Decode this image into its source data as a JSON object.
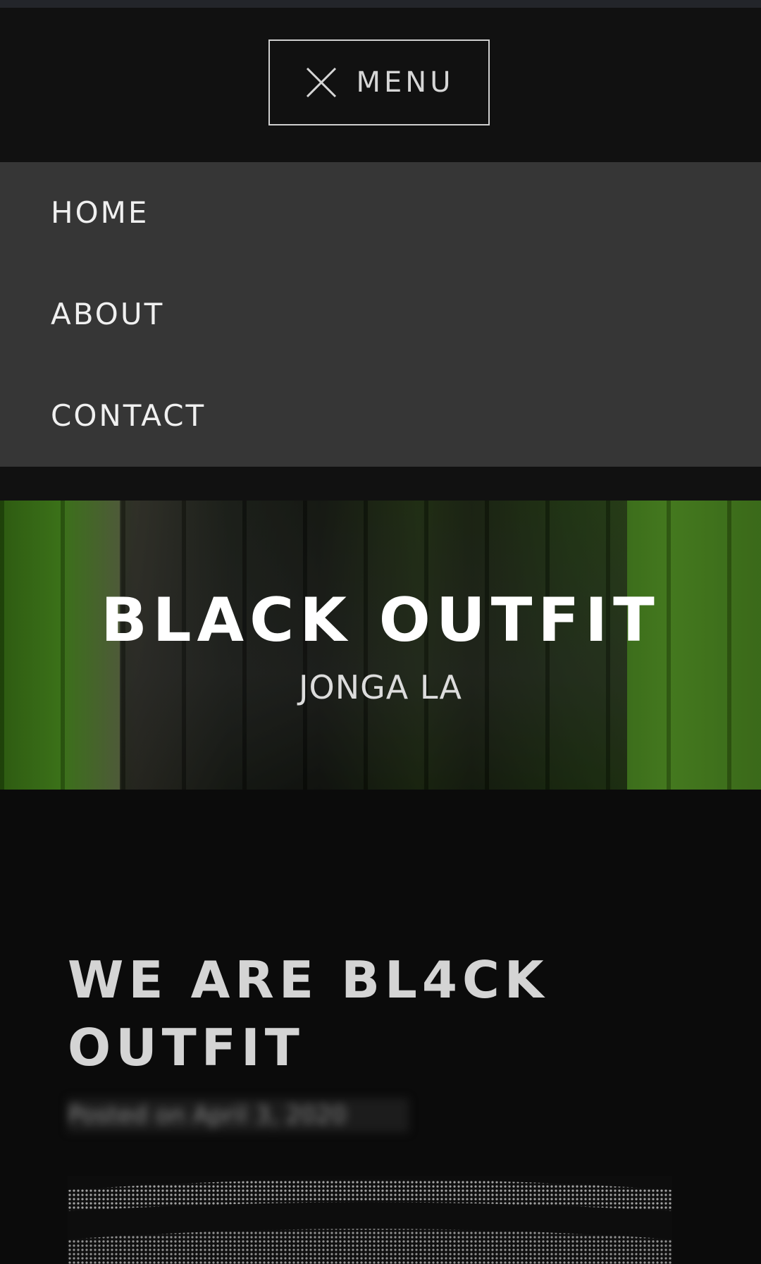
{
  "header": {
    "menu_label": "MENU",
    "menu_icon": "close-icon"
  },
  "nav": {
    "items": [
      {
        "label": "HOME"
      },
      {
        "label": "ABOUT"
      },
      {
        "label": "CONTACT"
      }
    ]
  },
  "hero": {
    "title": "BLACK OUTFIT",
    "subtitle": "JONGA LA"
  },
  "post": {
    "title": "WE ARE BL4CK OUTFIT",
    "date": "Posted on April 3, 2020"
  },
  "colors": {
    "header_bg": "#111111",
    "nav_bg": "#363636",
    "page_bg": "#0b0b0b"
  }
}
